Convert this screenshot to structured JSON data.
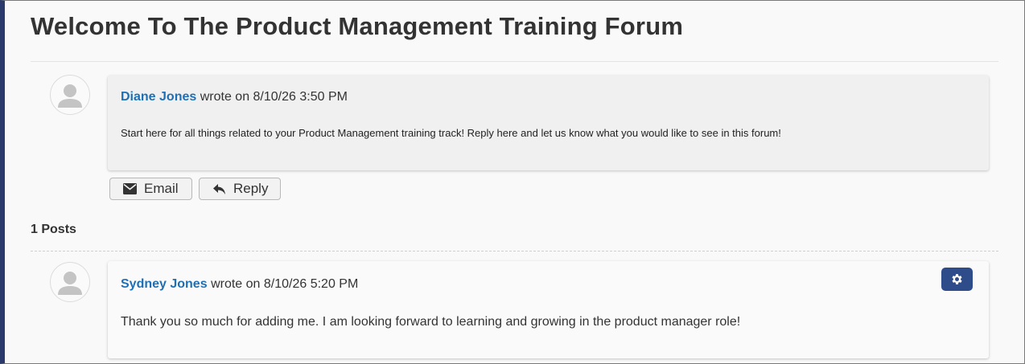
{
  "page": {
    "title": "Welcome To The Product Management Training Forum"
  },
  "main_post": {
    "author": "Diane Jones",
    "meta": "wrote on 8/10/26 3:50 PM",
    "body": "Start here for all things related to your Product Management training track! Reply here and let us know what you would like to see in this forum!"
  },
  "actions": {
    "email_label": "Email",
    "reply_label": "Reply"
  },
  "posts_count": "1 Posts",
  "replies": [
    {
      "author": "Sydney Jones",
      "meta": "wrote on 8/10/26 5:20 PM",
      "body": "Thank you so much for adding me. I am looking forward to learning and growing in the product manager role!"
    }
  ],
  "colors": {
    "accent": "#2f4c8a",
    "author_link": "#1f6fb5",
    "left_bar": "#2a3a6b"
  },
  "icons": [
    "user-avatar-icon",
    "envelope-icon",
    "reply-arrow-icon",
    "gear-icon"
  ]
}
